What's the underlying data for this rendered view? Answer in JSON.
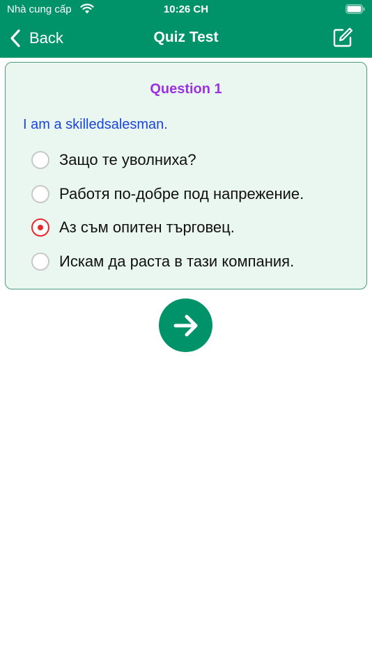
{
  "status_bar": {
    "carrier": "Nhà cung cấp",
    "time": "10:26 CH"
  },
  "nav": {
    "back_label": "Back",
    "title": "Quiz Test",
    "edit_icon": "edit-icon"
  },
  "question": {
    "title": "Question 1",
    "text": "I am a skilledsalesman.",
    "options": [
      {
        "label": "Защо те уволниха?",
        "selected": false
      },
      {
        "label": "Работя по-добре под напрежение.",
        "selected": false
      },
      {
        "label": "Аз съм опитен търговец.",
        "selected": true
      },
      {
        "label": "Искам да раста в тази компания.",
        "selected": false
      }
    ]
  },
  "next_button": {
    "icon": "arrow-right-icon"
  },
  "colors": {
    "header": "#00936a",
    "question_title": "#9a32e0",
    "question_text": "#1a44dc",
    "selected_radio": "#e8282b",
    "card_background": "#eaf6f0"
  }
}
